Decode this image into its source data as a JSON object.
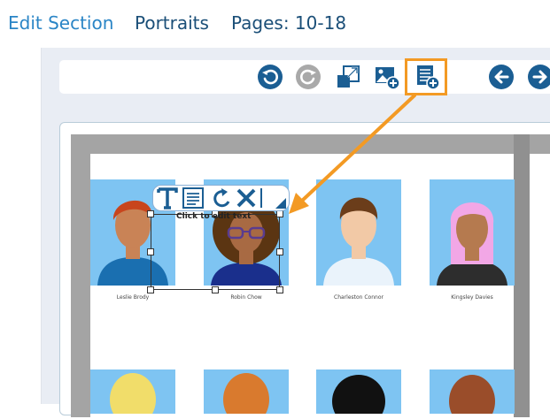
{
  "header": {
    "edit_section": "Edit Section",
    "section_name": "Portraits",
    "pages": "Pages: 10-18"
  },
  "toolbar": {
    "icons": [
      "undo-icon",
      "redo-icon",
      "resize-icon",
      "add-image-icon",
      "add-text-icon",
      "prev-page-icon",
      "next-page-icon"
    ],
    "accent": "#1b5e93",
    "highlight_color": "#f39a24"
  },
  "selection": {
    "hint": "Click to edit text",
    "tools": [
      "text-tool-icon",
      "align-icon",
      "rotate-icon",
      "delete-icon",
      "resize-corner-icon"
    ]
  },
  "portraits": [
    {
      "name": "Leslie Brody"
    },
    {
      "name": "Robin Chow"
    },
    {
      "name": "Charleston Connor"
    },
    {
      "name": "Kingsley Davies"
    }
  ]
}
